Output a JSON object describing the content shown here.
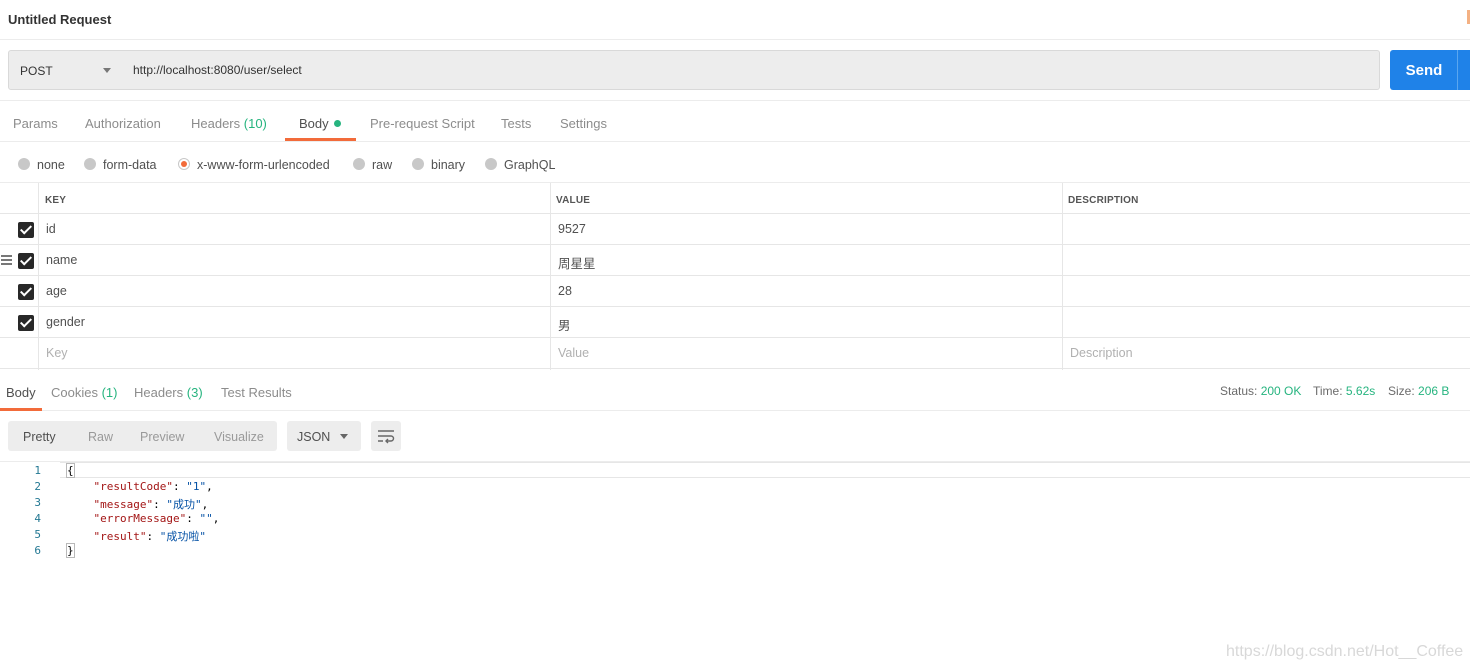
{
  "window": {
    "title": "Untitled Request"
  },
  "request": {
    "method": "POST",
    "url": "http://localhost:8080/user/select",
    "send_label": "Send"
  },
  "request_tabs": [
    {
      "label": "Params"
    },
    {
      "label": "Authorization"
    },
    {
      "label": "Headers",
      "count": "(10)"
    },
    {
      "label": "Body",
      "active": true
    },
    {
      "label": "Pre-request Script"
    },
    {
      "label": "Tests"
    },
    {
      "label": "Settings"
    }
  ],
  "body_types": [
    {
      "label": "none"
    },
    {
      "label": "form-data"
    },
    {
      "label": "x-www-form-urlencoded",
      "selected": true
    },
    {
      "label": "raw"
    },
    {
      "label": "binary"
    },
    {
      "label": "GraphQL"
    }
  ],
  "params_table": {
    "headers": [
      "KEY",
      "VALUE",
      "DESCRIPTION"
    ],
    "rows": [
      {
        "checked": true,
        "key": "id",
        "value": "9527",
        "description": ""
      },
      {
        "checked": true,
        "key": "name",
        "value": "周星星",
        "description": ""
      },
      {
        "checked": true,
        "key": "age",
        "value": "28",
        "description": ""
      },
      {
        "checked": true,
        "key": "gender",
        "value": "男",
        "description": ""
      }
    ],
    "placeholders": {
      "key": "Key",
      "value": "Value",
      "description": "Description"
    }
  },
  "response_tabs": [
    {
      "label": "Body",
      "active": true
    },
    {
      "label": "Cookies",
      "count": "(1)"
    },
    {
      "label": "Headers",
      "count": "(3)"
    },
    {
      "label": "Test Results"
    }
  ],
  "response_status": {
    "status_label": "Status:",
    "status_value": "200 OK",
    "time_label": "Time:",
    "time_value": "5.62s",
    "size_label": "Size:",
    "size_value": "206 B"
  },
  "view_modes": [
    "Pretty",
    "Raw",
    "Preview",
    "Visualize"
  ],
  "format": "JSON",
  "response_body": {
    "line_numbers": [
      "1",
      "2",
      "3",
      "4",
      "5",
      "6"
    ],
    "open_brace": "{",
    "close_brace": "}",
    "fields": [
      {
        "key": "\"resultCode\"",
        "value": "\"1\"",
        "sep": ","
      },
      {
        "key": "\"message\"",
        "value": "\"成功\"",
        "sep": ","
      },
      {
        "key": "\"errorMessage\"",
        "value": "\"\"",
        "sep": ","
      },
      {
        "key": "\"result\"",
        "value": "\"成功啦\"",
        "sep": ""
      }
    ]
  },
  "watermark": "https://blog.csdn.net/Hot__Coffee",
  "colors": {
    "accent": "#f26b3a",
    "send": "#1f82e8",
    "count": "#26b47f"
  }
}
